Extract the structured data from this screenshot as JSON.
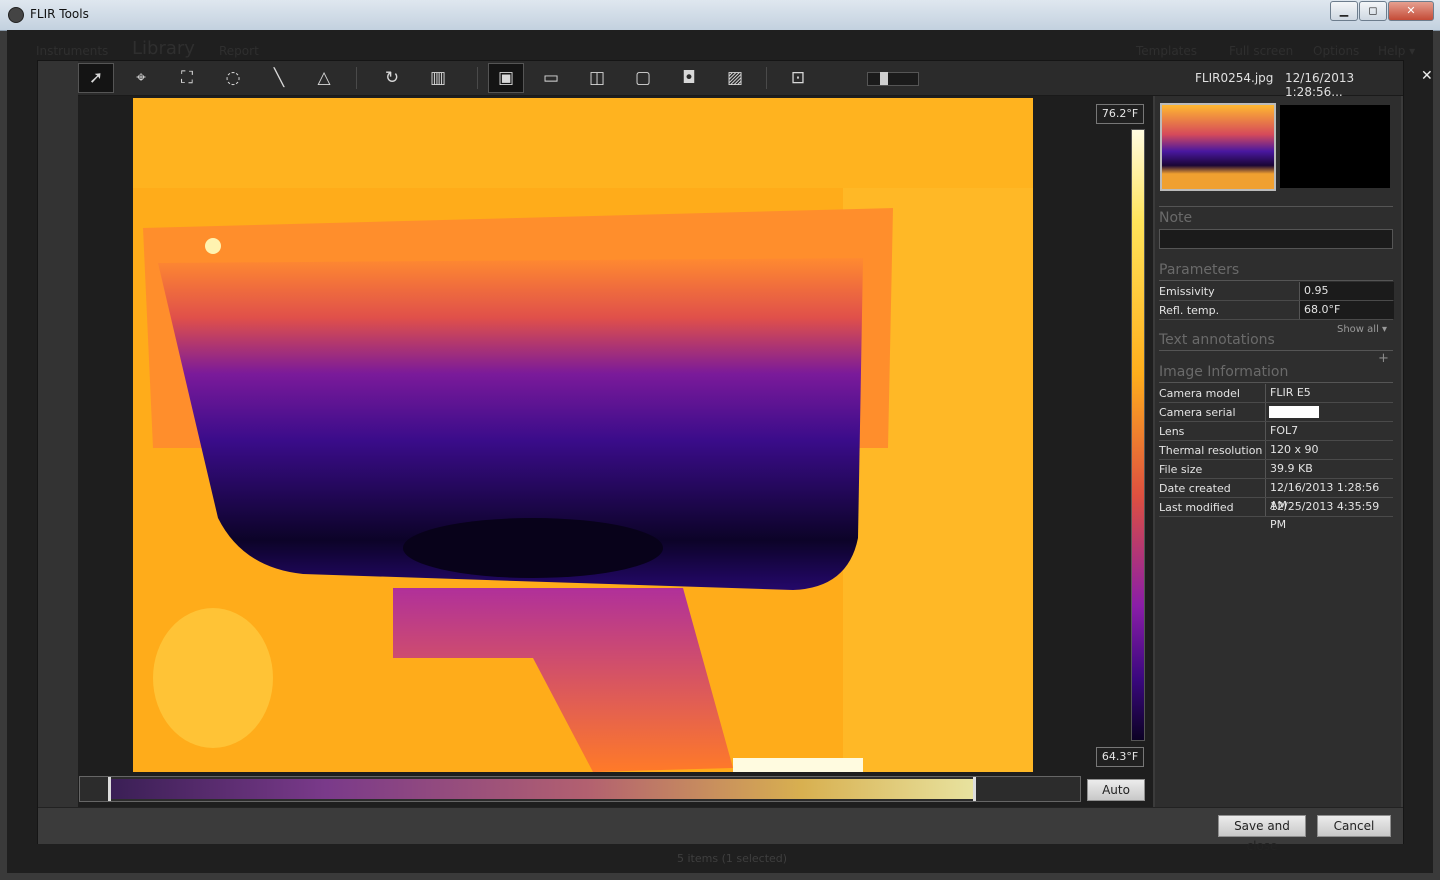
{
  "window": {
    "title": "FLIR Tools",
    "minimize": "▁",
    "maximize": "◻",
    "close": "✕"
  },
  "background": {
    "nav": [
      "Instruments",
      "Library",
      "Report"
    ],
    "right_nav": [
      "Templates",
      "Full screen",
      "Options",
      "Help ▾"
    ],
    "status": "5 items  (1 selected)"
  },
  "toolbar": {
    "icons": [
      "pointer-icon",
      "spotmeter-icon",
      "box-area-icon",
      "ellipse-area-icon",
      "line-icon",
      "delta-icon",
      "rotate-icon",
      "palette-icon",
      "image-mode-thermal-icon",
      "image-mode-msx-icon",
      "image-mode-blend-icon",
      "image-mode-pip-icon",
      "image-mode-photo-icon",
      "image-mode-digital-icon",
      "fit-icon"
    ]
  },
  "file": {
    "name": "FLIR0254.jpg",
    "datetime": "12/16/2013 1:28:56...",
    "close": "✕"
  },
  "scale": {
    "max": "76.2°F",
    "min": "64.3°F",
    "auto_label": "Auto"
  },
  "panel": {
    "note_title": "Note",
    "parameters_title": "Parameters",
    "parameters": [
      {
        "label": "Emissivity",
        "value": "0.95"
      },
      {
        "label": "Refl. temp.",
        "value": "68.0°F"
      }
    ],
    "show_all": "Show all ▾",
    "text_annotations_title": "Text annotations",
    "add": "+",
    "image_info_title": "Image Information",
    "info": [
      {
        "label": "Camera model",
        "value": "FLIR E5"
      },
      {
        "label": "Camera serial",
        "value": ""
      },
      {
        "label": "Lens",
        "value": "FOL7"
      },
      {
        "label": "Thermal resolution",
        "value": "120 x 90"
      },
      {
        "label": "File size",
        "value": "39.9 KB"
      },
      {
        "label": "Date created",
        "value": "12/16/2013 1:28:56 AM"
      },
      {
        "label": "Last modified",
        "value": "12/25/2013 4:35:59 PM"
      }
    ]
  },
  "footer": {
    "save_close": "Save and close",
    "cancel": "Cancel"
  }
}
